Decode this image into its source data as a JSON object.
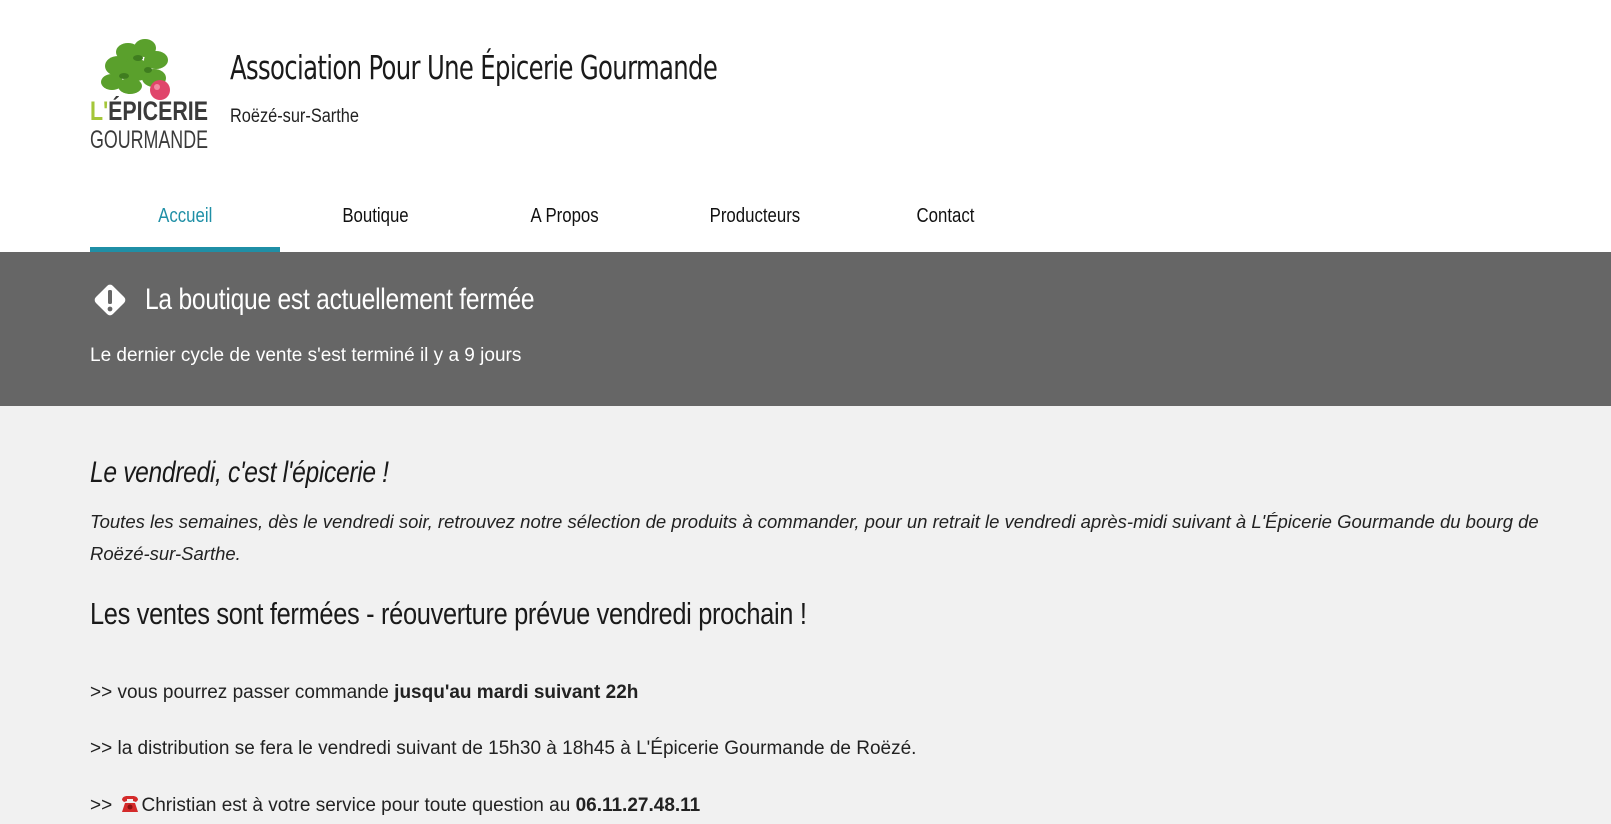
{
  "header": {
    "logo": {
      "line1_prefix": "L'",
      "line1_main": "ÉPICERIE",
      "line2": "GOURMANDE",
      "colors": {
        "prefix": "#a4c639",
        "leaves": "#5aa02c",
        "radish": "#e0456b",
        "text": "#3a3a3a"
      }
    },
    "title": "Association Pour Une Épicerie Gourmande",
    "subtitle": "Roëzé-sur-Sarthe"
  },
  "nav": {
    "items": [
      {
        "label": "Accueil",
        "active": true
      },
      {
        "label": "Boutique",
        "active": false
      },
      {
        "label": "A Propos",
        "active": false
      },
      {
        "label": "Producteurs",
        "active": false
      },
      {
        "label": "Contact",
        "active": false
      }
    ],
    "accent_color": "#1f8fa6"
  },
  "status_banner": {
    "icon": "warning-diamond-icon",
    "title": "La boutique est actuellement fermée",
    "note": "Le dernier cycle de vente s'est terminé il y a 9 jours",
    "background": "#666666"
  },
  "content": {
    "intro_heading": "Le vendredi, c'est l'épicerie !",
    "intro_text": "Toutes les semaines, dès le vendredi soir, retrouvez notre sélection de produits à commander, pour un retrait le vendredi après-midi suivant à L'Épicerie Gourmande du bourg de Roëzé-sur-Sarthe.",
    "sales_heading": "Les ventes sont fermées - réouverture prévue vendredi prochain !",
    "order_line": {
      "prefix": ">> vous pourrez passer commande ",
      "emphasis": "jusqu'au mardi suivant 22h"
    },
    "distribution_line": ">> la distribution se fera le vendredi suivant de 15h30 à 18h45 à L'Épicerie Gourmande de Roëzé.",
    "contact_line": {
      "prefix": ">> ",
      "icon": "telephone-icon",
      "text": "Christian est à votre service pour toute question au ",
      "phone": "06.11.27.48.11"
    }
  }
}
